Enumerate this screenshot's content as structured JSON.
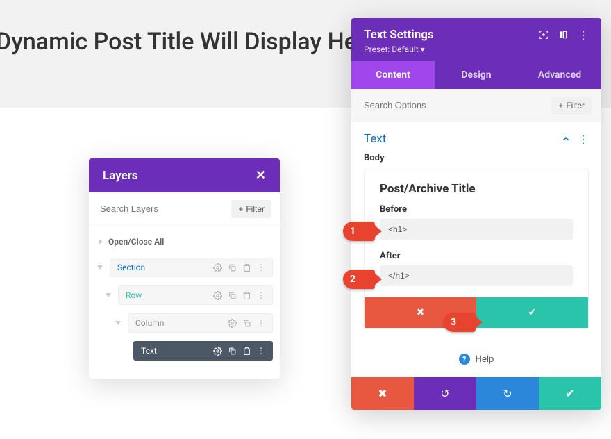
{
  "hero": {
    "title": "Dynamic Post Title Will Display Here"
  },
  "layers": {
    "title": "Layers",
    "search_placeholder": "Search Layers",
    "filter_label": "Filter",
    "open_close": "Open/Close All",
    "items": {
      "section": "Section",
      "row": "Row",
      "column": "Column",
      "text": "Text"
    }
  },
  "settings": {
    "title": "Text Settings",
    "preset": "Preset: Default",
    "tabs": {
      "content": "Content",
      "design": "Design",
      "advanced": "Advanced"
    },
    "search_placeholder": "Search Options",
    "filter_label": "Filter",
    "section_title": "Text",
    "body_label": "Body",
    "dynamic": {
      "title": "Post/Archive Title",
      "before_label": "Before",
      "before_value": "<h1>",
      "after_label": "After",
      "after_value": "</h1>"
    },
    "help": "Help"
  },
  "callouts": {
    "c1": "1",
    "c2": "2",
    "c3": "3"
  }
}
